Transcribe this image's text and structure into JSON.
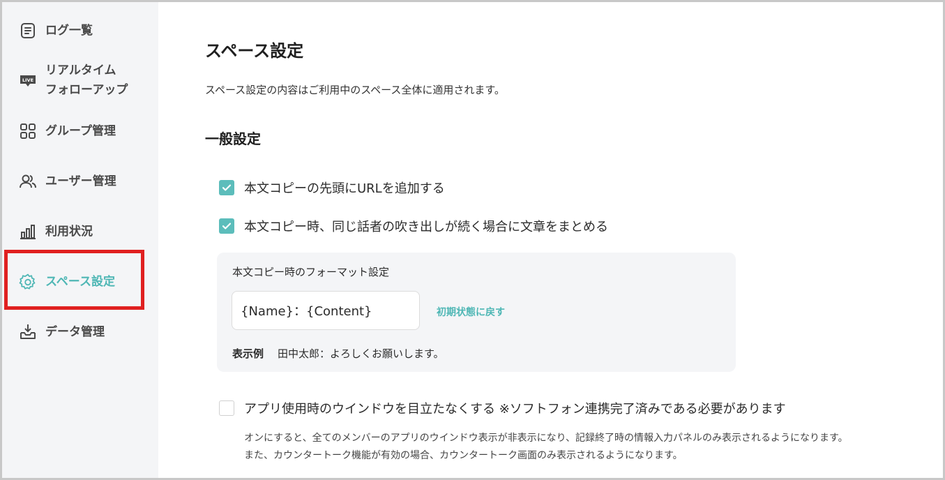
{
  "sidebar": {
    "items": [
      {
        "label": "ログ一覧",
        "icon": "document-list-icon"
      },
      {
        "label": "リアルタイム\nフォローアップ",
        "icon": "live-icon",
        "badge": "LIVE"
      },
      {
        "label": "グループ管理",
        "icon": "grid-icon"
      },
      {
        "label": "ユーザー管理",
        "icon": "users-icon"
      },
      {
        "label": "利用状況",
        "icon": "bar-chart-icon"
      },
      {
        "label": "スペース設定",
        "icon": "gear-icon",
        "active": true
      },
      {
        "label": "データ管理",
        "icon": "download-tray-icon"
      }
    ]
  },
  "main": {
    "title": "スペース設定",
    "description": "スペース設定の内容はご利用中のスペース全体に適用されます。",
    "general_section": {
      "title": "一般設定",
      "options": [
        {
          "label": "本文コピーの先頭にURLを追加する",
          "checked": true
        },
        {
          "label": "本文コピー時、同じ話者の吹き出しが続く場合に文章をまとめる",
          "checked": true
        }
      ],
      "format": {
        "title": "本文コピー時のフォーマット設定",
        "value": "{Name}：{Content}",
        "reset_label": "初期状態に戻す",
        "example_label": "表示例",
        "example_value": "田中太郎：よろしくお願いします。"
      },
      "window_option": {
        "label": "アプリ使用時のウインドウを目立たなくする ※ソフトフォン連携完了済みである必要があります",
        "checked": false,
        "note_line1": "オンにすると、全てのメンバーのアプリのウインドウ表示が非表示になり、記録終了時の情報入力パネルのみ表示されるようになります。",
        "note_line2": "また、カウンタートーク機能が有効の場合、カウンタートーク画面のみ表示されるようになります。"
      }
    }
  },
  "colors": {
    "accent": "#4fb7b5",
    "checkbox": "#5cbdbb",
    "highlight": "#e02020",
    "sidebar_bg": "#f4f5f7"
  }
}
